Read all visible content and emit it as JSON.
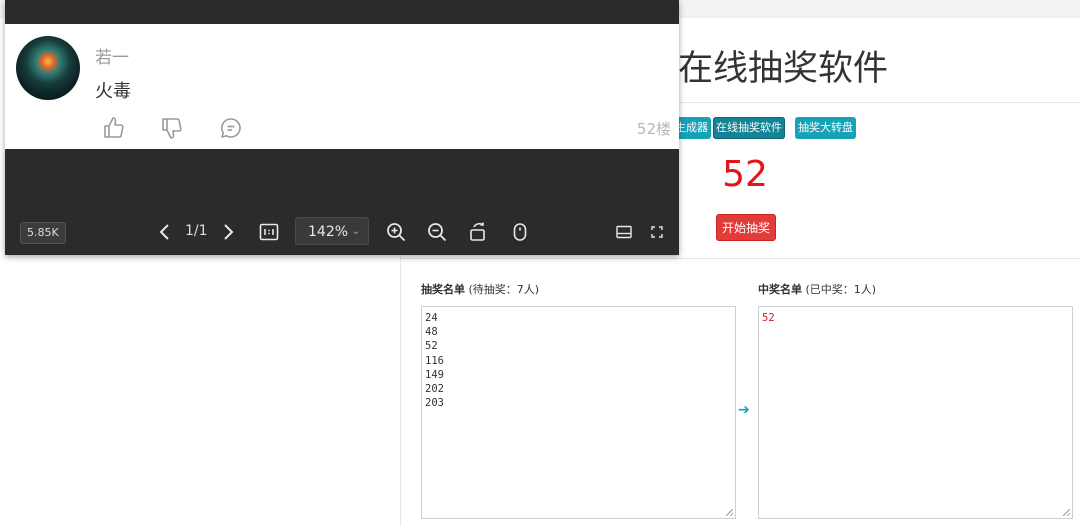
{
  "page": {
    "title": "在线抽奖软件",
    "tags": [
      {
        "label": "生成器"
      },
      {
        "label": "在线抽奖软件"
      },
      {
        "label": "抽奖大转盘"
      }
    ],
    "result_number": "52",
    "start_button": "开始抽奖",
    "pool": {
      "label": "抽奖名单",
      "note": "(待抽奖：7人)",
      "entries": [
        "24",
        "48",
        "52",
        "116",
        "149",
        "202",
        "203"
      ]
    },
    "winners": {
      "label": "中奖名单",
      "note": "(已中奖：1人)",
      "entries": [
        "52"
      ]
    },
    "arrow": "➔"
  },
  "viewer": {
    "comment": {
      "username": "若一",
      "text": "火毒",
      "floor": "52楼"
    },
    "toolbar": {
      "file_size": "5.85K",
      "page": "1/1",
      "zoom": "142%"
    }
  },
  "colors": {
    "accent": "#17a2b8",
    "result_red": "#e3141a",
    "start_button": "#e33a3a",
    "viewer_bg": "#2b2b2b"
  }
}
